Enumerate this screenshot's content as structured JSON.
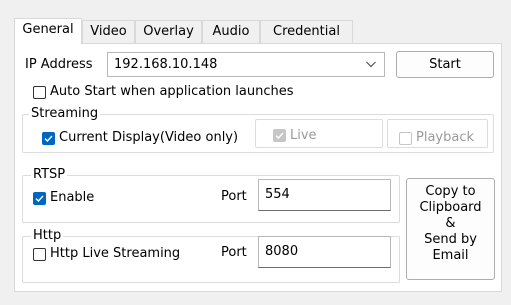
{
  "tabs": [
    {
      "label": "General",
      "active": true
    },
    {
      "label": "Video",
      "active": false
    },
    {
      "label": "Overlay",
      "active": false
    },
    {
      "label": "Audio",
      "active": false
    },
    {
      "label": "Credential",
      "active": false
    }
  ],
  "general": {
    "ip_label": "IP Address",
    "ip_value": "192.168.10.148",
    "start_button": "Start",
    "auto_start_label": "Auto Start when application launches",
    "auto_start_checked": false
  },
  "streaming": {
    "group_label": "Streaming",
    "current_display_label": "Current Display(Video only)",
    "current_display_checked": true,
    "live_label": "Live",
    "live_checked": true,
    "live_enabled": false,
    "playback_label": "Playback",
    "playback_checked": false,
    "playback_enabled": false
  },
  "rtsp": {
    "group_label": "RTSP",
    "enable_label": "Enable",
    "enable_checked": true,
    "port_label": "Port",
    "port_value": "554"
  },
  "http": {
    "group_label": "Http",
    "live_streaming_label": "Http Live Streaming",
    "live_streaming_checked": false,
    "port_label": "Port",
    "port_value": "8080"
  },
  "copy_button": {
    "line1": "Copy to",
    "line2": "Clipboard",
    "line3": "&",
    "line4": "Send by",
    "line5": "Email"
  },
  "colors": {
    "accent": "#0067c0",
    "window_bg": "#f0f0f0",
    "panel_bg": "#ffffff",
    "disabled": "#9a9a9a"
  },
  "icons": {
    "combo_arrow": "chevron-down-icon",
    "check": "checkmark-icon"
  }
}
